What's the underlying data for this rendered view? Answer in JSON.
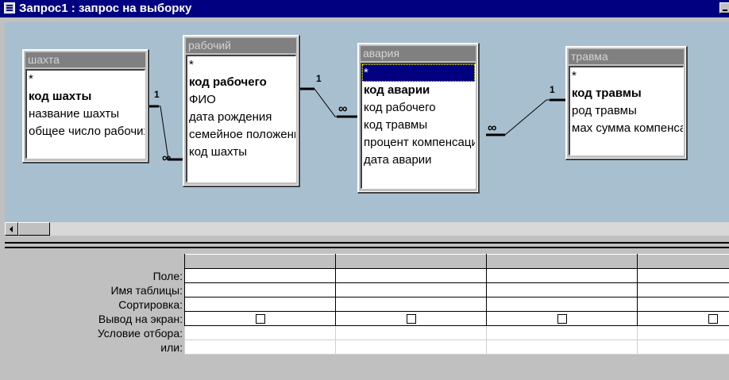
{
  "window": {
    "title": "Запрос1 : запрос на выборку",
    "icon": "query-icon"
  },
  "tables": [
    {
      "title": "шахта",
      "fields": [
        {
          "label": "*",
          "key": false
        },
        {
          "label": "код шахты",
          "key": true
        },
        {
          "label": "название шахты",
          "key": false
        },
        {
          "label": "общее число рабочих",
          "key": false
        }
      ]
    },
    {
      "title": "рабочий",
      "fields": [
        {
          "label": "*",
          "key": false
        },
        {
          "label": "код рабочего",
          "key": true
        },
        {
          "label": "ФИО",
          "key": false
        },
        {
          "label": "дата рождения",
          "key": false
        },
        {
          "label": "семейное положение",
          "key": false
        },
        {
          "label": "код шахты",
          "key": false
        }
      ]
    },
    {
      "title": "авария",
      "fields": [
        {
          "label": "*",
          "key": false,
          "selected": true
        },
        {
          "label": "код аварии",
          "key": true
        },
        {
          "label": "код рабочего",
          "key": false
        },
        {
          "label": "код травмы",
          "key": false
        },
        {
          "label": "процент компенсации",
          "key": false
        },
        {
          "label": "дата аварии",
          "key": false
        }
      ]
    },
    {
      "title": "травма",
      "fields": [
        {
          "label": "*",
          "key": false
        },
        {
          "label": "код травмы",
          "key": true
        },
        {
          "label": "род травмы",
          "key": false
        },
        {
          "label": "мах сумма компенсации",
          "key": false
        }
      ]
    }
  ],
  "relations": [
    {
      "one": "1",
      "many": "∞"
    },
    {
      "one": "1",
      "many": "∞"
    },
    {
      "one": "1",
      "many": "∞"
    }
  ],
  "grid": {
    "row_labels": [
      "Поле:",
      "Имя таблицы:",
      "Сортировка:",
      "Вывод на экран:",
      "Условие отбора:",
      "или:"
    ],
    "columns": 4,
    "show_checkbox_row": 3
  }
}
